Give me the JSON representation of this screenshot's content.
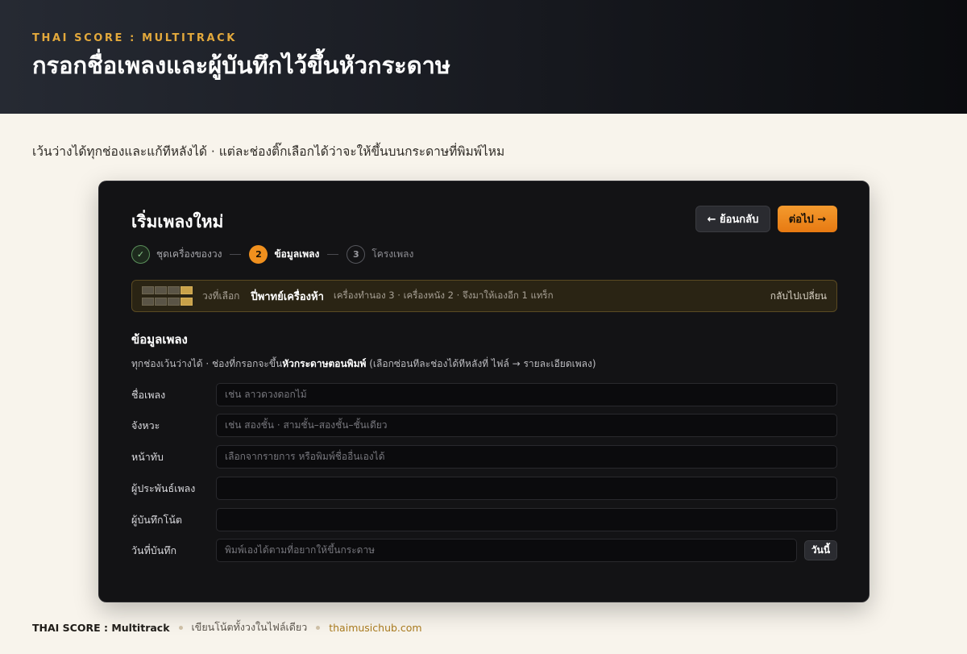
{
  "hero": {
    "eyebrow": "THAI SCORE : MULTITRACK",
    "title": "กรอกชื่อเพลงและผู้บันทึกไว้ขึ้นหัวกระดาษ"
  },
  "subtitle": "เว้นว่างได้ทุกช่องและแก้ทีหลังได้ · แต่ละช่องติ๊กเลือกได้ว่าจะให้ขึ้นบนกระดาษที่พิมพ์ไหม",
  "panel": {
    "title": "เริ่มเพลงใหม่",
    "back_label": "← ย้อนกลับ",
    "next_label": "ต่อไป →",
    "steps": [
      {
        "number": "✓",
        "label": "ชุดเครื่องของวง",
        "state": "done"
      },
      {
        "number": "2",
        "label": "ข้อมูลเพลง",
        "state": "active"
      },
      {
        "number": "3",
        "label": "โครงเพลง",
        "state": "todo"
      }
    ],
    "band": {
      "label": "วงที่เลือก",
      "name": "ปี่พาทย์เครื่องห้า",
      "description": "เครื่องทำนอง 3 · เครื่องหนัง 2 · จึงมาให้เองอีก 1 แทร็ก",
      "change_link": "กลับไปเปลี่ยน"
    },
    "section_title": "ข้อมูลเพลง",
    "section_note_prefix": "ทุกช่องเว้นว่างได้ · ช่องที่กรอกจะขึ้น",
    "section_note_bold": "หัวกระดาษตอนพิมพ์",
    "section_note_suffix": " (เลือกซ่อนทีละช่องได้ทีหลังที่ ไฟล์ → รายละเอียดเพลง)",
    "fields": [
      {
        "label": "ชื่อเพลง",
        "placeholder": "เช่น ลาวดวงดอกไม้"
      },
      {
        "label": "จังหวะ",
        "placeholder": "เช่น สองชั้น · สามชั้น–สองชั้น–ชั้นเดียว"
      },
      {
        "label": "หน้าทับ",
        "placeholder": "เลือกจากรายการ หรือพิมพ์ชื่ออื่นเองได้"
      },
      {
        "label": "ผู้ประพันธ์เพลง",
        "placeholder": ""
      },
      {
        "label": "ผู้บันทึกโน้ต",
        "placeholder": ""
      },
      {
        "label": "วันที่บันทึก",
        "placeholder": "พิมพ์เองได้ตามที่อยากให้ขึ้นกระดาษ"
      }
    ],
    "today_label": "วันนี้"
  },
  "footer": {
    "brand": "THAI SCORE : Multitrack",
    "tagline": "เขียนโน้ตทั้งวงในไฟล์เดียว",
    "link": "thaimusichub.com"
  }
}
